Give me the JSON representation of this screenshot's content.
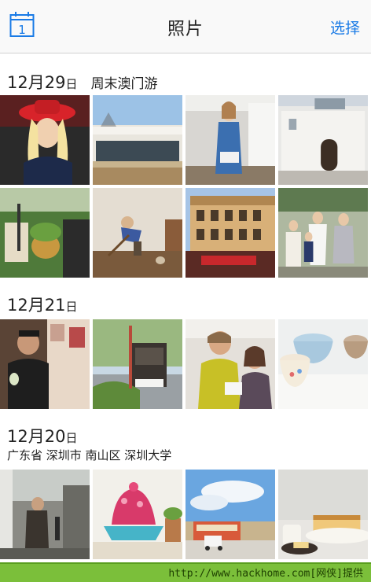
{
  "nav": {
    "calendar_day": "1",
    "title": "照片",
    "select_label": "选择"
  },
  "sections": [
    {
      "date_main": "12月29",
      "date_suffix": "日",
      "place": "周末澳门游",
      "subtitle": ""
    },
    {
      "date_main": "12月21",
      "date_suffix": "日",
      "place": "",
      "subtitle": ""
    },
    {
      "date_main": "12月20",
      "date_suffix": "日",
      "place": "",
      "subtitle": "广东省 深圳市 南山区 深圳大学"
    }
  ],
  "watermark": "http://www.hackhome.com[网侠]提供",
  "colors": {
    "accent": "#1a7be6",
    "watermark_bg": "#7bbf3a"
  }
}
